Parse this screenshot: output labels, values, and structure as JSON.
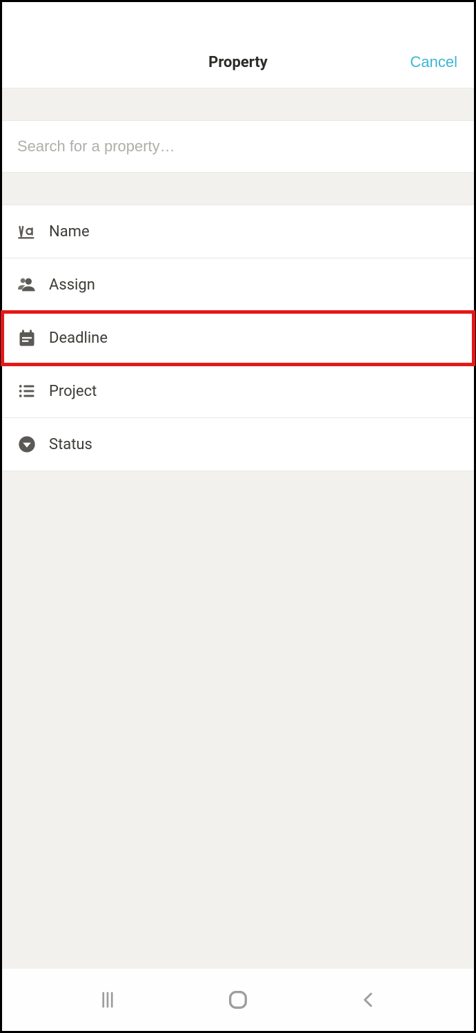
{
  "header": {
    "title": "Property",
    "cancel": "Cancel"
  },
  "search": {
    "placeholder": "Search for a property…",
    "value": ""
  },
  "properties": [
    {
      "label": "Name",
      "icon": "text-icon",
      "highlighted": false
    },
    {
      "label": "Assign",
      "icon": "people-icon",
      "highlighted": false
    },
    {
      "label": "Deadline",
      "icon": "calendar-icon",
      "highlighted": true
    },
    {
      "label": "Project",
      "icon": "list-icon",
      "highlighted": false
    },
    {
      "label": "Status",
      "icon": "dropdown-icon",
      "highlighted": false
    }
  ]
}
